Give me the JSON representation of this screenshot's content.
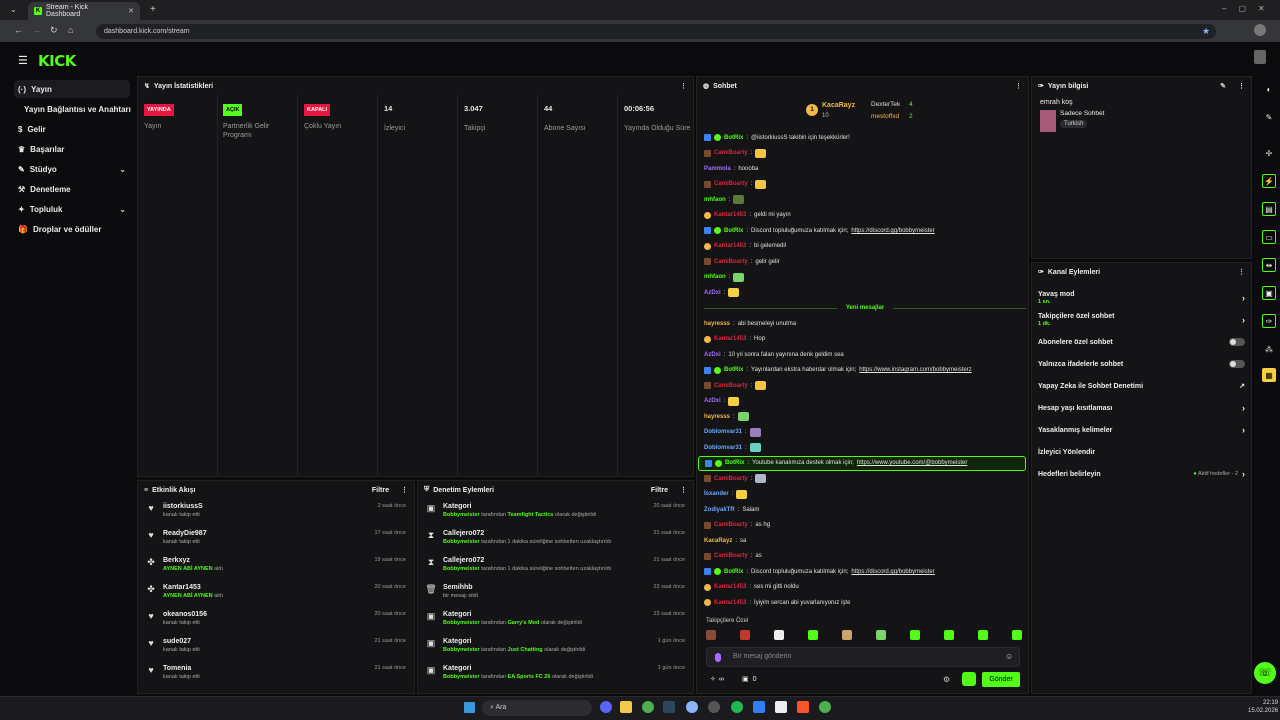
{
  "browser": {
    "tab_title": "Stream - Kick Dashboard",
    "url": "dashboard.kick.com/stream"
  },
  "brand": {
    "logo": "KICK",
    "accent": "#53fc18"
  },
  "sidebar": {
    "items": [
      {
        "label": "Yayın"
      },
      {
        "label": "Yayın Bağlantısı ve Anahtarı"
      },
      {
        "label": "Gelir"
      },
      {
        "label": "Başarılar"
      },
      {
        "label": "Stüdyo"
      },
      {
        "label": "Denetleme"
      },
      {
        "label": "Topluluk"
      },
      {
        "label": "Droplar ve ödüller"
      }
    ]
  },
  "stats": {
    "title": "Yayın İstatistikleri",
    "items": [
      {
        "badge": "YAYINDA",
        "badge_color": "#e5173f",
        "label": "Yayın"
      },
      {
        "badge": "AÇIK",
        "badge_color": "#53fc18",
        "label": "Partnerlik Gelir Programı"
      },
      {
        "badge": "KAPALI",
        "badge_color": "#e5173f",
        "label": "Çoklu Yayın"
      },
      {
        "value": "14",
        "label": "İzleyici"
      },
      {
        "value": "3.047",
        "label": "Takipçi"
      },
      {
        "value": "44",
        "label": "Abone Sayısı"
      },
      {
        "value": "00:06:56",
        "label": "Yayında Olduğu Süre"
      }
    ]
  },
  "activity": {
    "title": "Etkinlik Akışı",
    "filter": "Filtre",
    "rows": [
      {
        "icon": "heart-icon",
        "name": "iistorkiussS",
        "sub": "kanalı takip etti",
        "time": "2 saat önce"
      },
      {
        "icon": "heart-icon",
        "name": "ReadyDie987",
        "sub": "kanalı takip etti",
        "time": "17 saat önce"
      },
      {
        "icon": "gift-icon",
        "name": "Berkxyz",
        "hl": "AYNEN ABİ AYNEN",
        "sub": "aldı",
        "time": "19 saat önce"
      },
      {
        "icon": "gift-icon",
        "name": "Kantar1453",
        "hl": "AYNEN ABİ AYNEN",
        "sub": "aldı",
        "time": "20 saat önce"
      },
      {
        "icon": "heart-icon",
        "name": "okeanos0156",
        "sub": "kanalı takip etti",
        "time": "20 saat önce"
      },
      {
        "icon": "heart-icon",
        "name": "sude027",
        "sub": "kanalı takip etti",
        "time": "21 saat önce"
      },
      {
        "icon": "heart-icon",
        "name": "Tomenia",
        "sub": "kanalı takip etti",
        "time": "21 saat önce"
      }
    ]
  },
  "moderation": {
    "title": "Denetim Eylemleri",
    "filter": "Filtre",
    "rows": [
      {
        "icon": "category-icon",
        "name": "Kategori",
        "by": "Bobbymeister",
        "mid": "tarafından",
        "hl": "Teamfight Tactics",
        "end": "olarak değiştirildi",
        "time": "20 saat önce"
      },
      {
        "icon": "hourglass-icon",
        "name": "Callejero072",
        "by": "Bobbymeister",
        "mid": "tarafından 1 dakika süreliğine sohbetten uzaklaştırıldı",
        "hl": "",
        "end": "",
        "time": "21 saat önce"
      },
      {
        "icon": "hourglass-icon",
        "name": "Callejero072",
        "by": "Bobbymeister",
        "mid": "tarafından 1 dakika süreliğine sohbetten uzaklaştırıldı",
        "hl": "",
        "end": "",
        "time": "21 saat önce"
      },
      {
        "icon": "trash-icon",
        "name": "Semihhb",
        "by": "",
        "mid": "bir mesajı sildi",
        "hl": "",
        "end": "",
        "time": "23 saat önce"
      },
      {
        "icon": "category-icon",
        "name": "Kategori",
        "by": "Bobbymeister",
        "mid": "tarafından",
        "hl": "Garry's Mod",
        "end": "olarak değiştirildi",
        "time": "23 saat önce"
      },
      {
        "icon": "category-icon",
        "name": "Kategori",
        "by": "Bobbymeister",
        "mid": "tarafından",
        "hl": "Just Chatting",
        "end": "olarak değiştirildi",
        "time": "1 gün önce"
      },
      {
        "icon": "category-icon",
        "name": "Kategori",
        "by": "Bobbymeister",
        "mid": "tarafından",
        "hl": "EA Sports FC 26",
        "end": "olarak değiştirildi",
        "time": "1 gün önce"
      }
    ]
  },
  "chat": {
    "title": "Sohbet",
    "leaders": [
      {
        "rank": "1",
        "name": "KacaRayz",
        "count": "10"
      },
      {
        "name": "DexterTek",
        "count": "4"
      },
      {
        "name": "mestoffxd",
        "count": "2"
      }
    ],
    "divider": "Yeni mesajlar",
    "messages": [
      {
        "user": "BotRix",
        "color": "#53fc18",
        "text": "@iistorkiussS takibin için teşekkürler!",
        "bot": true
      },
      {
        "user": "CamiBoarty",
        "color": "#e0243a",
        "text": "",
        "emote": "#f5c542"
      },
      {
        "user": "Pammola",
        "color": "#a66bff",
        "text": "hoooba"
      },
      {
        "user": "CamiBoarty",
        "color": "#e0243a",
        "text": "",
        "emote": "#f5c542"
      },
      {
        "user": "mhfaon",
        "color": "#53fc18",
        "text": "",
        "emote": "#5b7a3a"
      },
      {
        "user": "Kantar1453",
        "color": "#e0243a",
        "text": "geldi mi yayın",
        "coin": true
      },
      {
        "user": "BotRix",
        "color": "#53fc18",
        "text": "Discord topluluğumuza katılmak için;",
        "link": "https://discord.gg/bobbymeister",
        "bot": true
      },
      {
        "user": "Kantar1453",
        "color": "#e0243a",
        "text": "bi gelemedil",
        "coin": true
      },
      {
        "user": "CamiBoarty",
        "color": "#e0243a",
        "text": "gelir gelir"
      },
      {
        "user": "mhfaon",
        "color": "#53fc18",
        "text": "",
        "emote": "#7bd46a"
      },
      {
        "user": "AzDxi",
        "color": "#a66bff",
        "text": "",
        "emote": "#f5d142"
      },
      {
        "divider": true
      },
      {
        "user": "hayresss",
        "color": "#f2b84b",
        "text": "abi besmeleyi unutma"
      },
      {
        "user": "Kantar1453",
        "color": "#e0243a",
        "text": "Hop",
        "coin": true
      },
      {
        "user": "AzDxi",
        "color": "#a66bff",
        "text": "10 yıl sonra falan yayınına denk geldim sea"
      },
      {
        "user": "BotRix",
        "color": "#53fc18",
        "text": "Yayınlardan ekstra haberdar olmak için;",
        "link": "https://www.instagram.com/bobbymeisterz",
        "bot": true
      },
      {
        "user": "CamiBoarty",
        "color": "#e0243a",
        "text": "",
        "emote": "#f5c542"
      },
      {
        "user": "AzDxi",
        "color": "#a66bff",
        "text": "",
        "emote": "#f5d142"
      },
      {
        "user": "hayresss",
        "color": "#f2b84b",
        "text": "",
        "emote": "#7bd46a"
      },
      {
        "user": "Doblomvar31",
        "color": "#6aa7ff",
        "text": "",
        "emote": "#9a7fbf"
      },
      {
        "user": "Doblomvar31",
        "color": "#6aa7ff",
        "text": "",
        "emote": "#6ad0c4"
      },
      {
        "user": "BotRix",
        "color": "#53fc18",
        "text": "Youtube kanalımıza destek olmak için;",
        "link": "https://www.youtube.com/@bobbymeister",
        "bot": true,
        "highlight": true
      },
      {
        "user": "CamiBoarty",
        "color": "#e0243a",
        "text": "",
        "emote": "#b0b7c8"
      },
      {
        "user": "İsxander",
        "color": "#6aa7ff",
        "text": "",
        "emote": "#f5d142"
      },
      {
        "user": "ZodiyakTR",
        "color": "#6aa7ff",
        "text": "Salam"
      },
      {
        "user": "CamiBoarty",
        "color": "#e0243a",
        "text": "as hg"
      },
      {
        "user": "KacaRayz",
        "color": "#f2b84b",
        "text": "sa"
      },
      {
        "user": "CamiBoarty",
        "color": "#e0243a",
        "text": "as"
      },
      {
        "user": "BotRix",
        "color": "#53fc18",
        "text": "Discord topluluğumuza katılmak için;",
        "link": "https://discord.gg/bobbymeister",
        "bot": true
      },
      {
        "user": "Kantar1453",
        "color": "#e0243a",
        "text": "ses mi gitti noldu",
        "coin": true
      },
      {
        "user": "Kantar1453",
        "color": "#e0243a",
        "text": "İyiyim sercan abi yuvarlanıyoruz işte",
        "coin": true
      }
    ],
    "emote_bar_label": "Takipçilere Özel",
    "input_placeholder": "Bir mesaj gönderin",
    "points": "∞",
    "gift_count": "0",
    "send_label": "Gönder"
  },
  "stream_info": {
    "title": "Yayın bilgisi",
    "stream_title": "emrah koş",
    "category": "Sadece Sohbet",
    "tag": "Turkish"
  },
  "channel_actions": {
    "title": "Kanal Eylemleri",
    "items": [
      {
        "label": "Yavaş mod",
        "sub": "1 sn.",
        "type": "chevron"
      },
      {
        "label": "Takipçilere özel sohbet",
        "sub": "1 dk.",
        "type": "chevron"
      },
      {
        "label": "Abonelere özel sohbet",
        "type": "toggle"
      },
      {
        "label": "Yalnızca ifadelerle sohbet",
        "type": "toggle"
      },
      {
        "label": "Yapay Zeka ile Sohbet Denetimi",
        "type": "external"
      },
      {
        "label": "Hesap yaşı kısıtlaması",
        "type": "chevron"
      },
      {
        "label": "Yasaklanmış kelimeler",
        "type": "chevron"
      },
      {
        "label": "İzleyici Yönlendir",
        "type": "none"
      },
      {
        "label": "Hedefleri belirleyin",
        "type": "goal",
        "extra": "Aktif hedefler - 2"
      }
    ]
  },
  "taskbar": {
    "search": "Ara",
    "time": "22:19",
    "date": "15.02.2026"
  }
}
